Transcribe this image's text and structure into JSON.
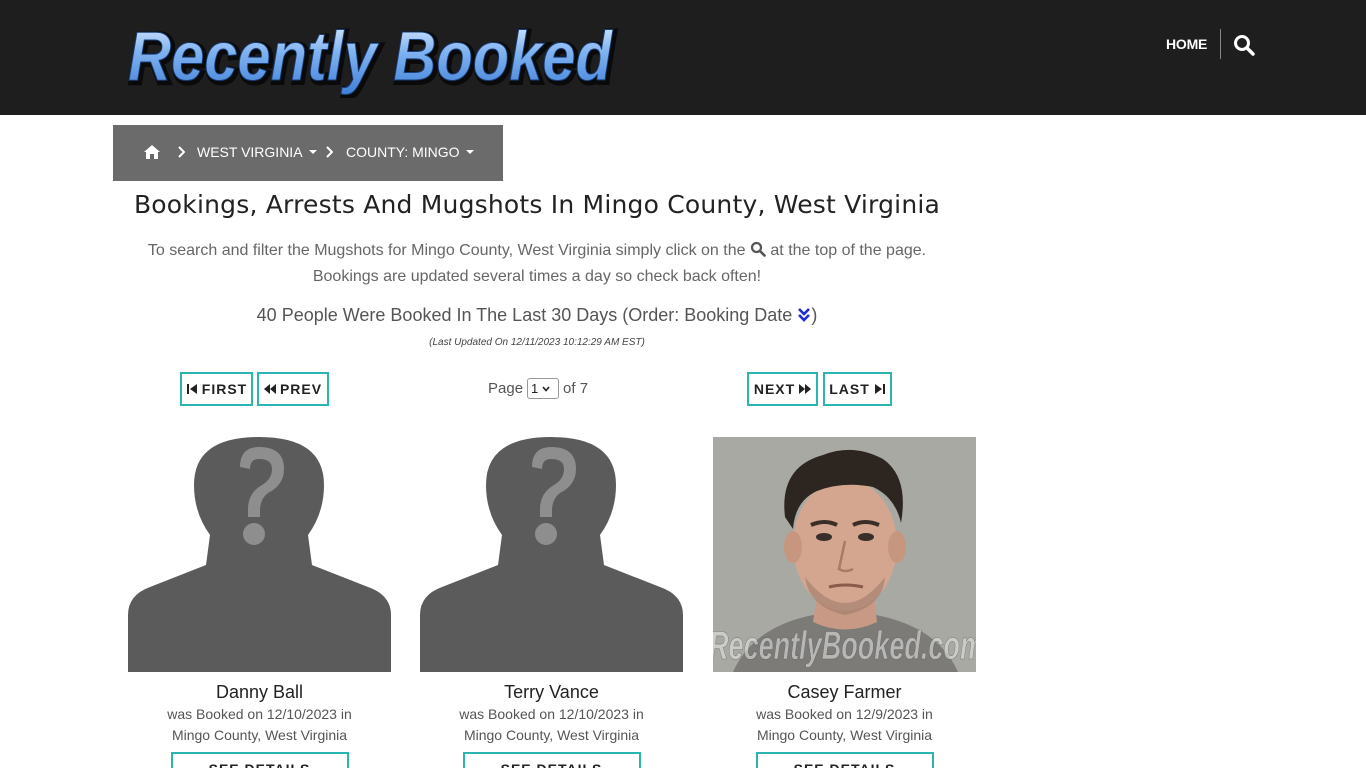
{
  "header": {
    "logo_text": "Recently Booked",
    "nav_home": "HOME"
  },
  "breadcrumb": {
    "state_label": "WEST VIRGINIA",
    "county_label": "COUNTY: MINGO"
  },
  "main": {
    "title": "Bookings, Arrests And Mugshots In Mingo County, West Virginia",
    "intro_line1_before": "To search and filter the Mugshots for Mingo County, West Virginia simply click on the",
    "intro_line1_after": "at the top of the page.",
    "intro_line2": "Bookings are updated several times a day so check back often!",
    "count_text": "40 People Were Booked In The Last 30 Days (Order: Booking Date",
    "count_close": ")",
    "last_updated": "(Last Updated On 12/11/2023 10:12:29 AM EST)"
  },
  "pagination": {
    "first": "FIRST",
    "prev": "PREV",
    "next": "NEXT",
    "last": "LAST",
    "page_label": "Page",
    "current_page": "1",
    "of_label": "of 7"
  },
  "bookings": [
    {
      "name": "Danny Ball",
      "line1": "was Booked on 12/10/2023 in",
      "line2": "Mingo County, West Virginia",
      "button": "SEE DETAILS",
      "photo": "placeholder-silhouette"
    },
    {
      "name": "Terry Vance",
      "line1": "was Booked on 12/10/2023 in",
      "line2": "Mingo County, West Virginia",
      "button": "SEE DETAILS",
      "photo": "placeholder-silhouette"
    },
    {
      "name": "Casey Farmer",
      "line1": "was Booked on 12/9/2023 in",
      "line2": "Mingo County, West Virginia",
      "button": "SEE DETAILS",
      "photo": "mugshot",
      "watermark": "RecentlyBooked.com"
    }
  ],
  "colors": {
    "header_bg": "#1e1e1e",
    "breadcrumb_bg": "#6b6b6b",
    "button_border": "#2bb5b2",
    "order_icon": "#1f2bd6"
  },
  "icons": {
    "nav_search": "search-icon",
    "breadcrumb_home": "home-icon",
    "breadcrumb_separator": "chevron-right-icon",
    "order": "double-chevron-down-icon"
  }
}
